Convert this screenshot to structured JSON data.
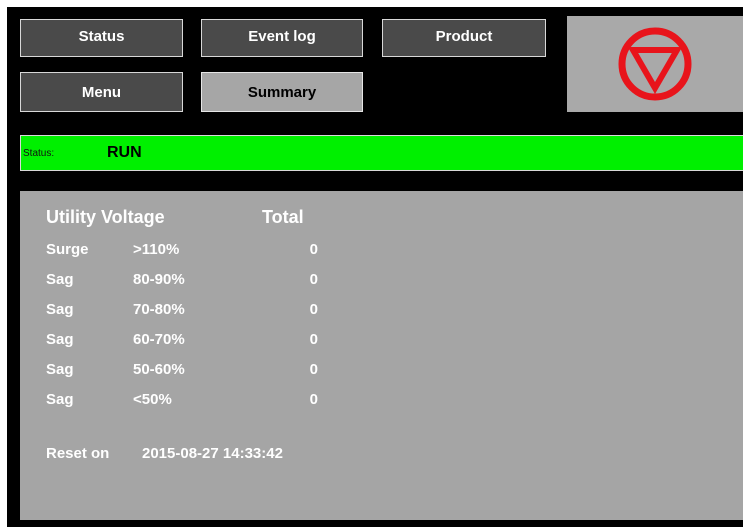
{
  "nav": {
    "status": "Status",
    "event_log": "Event log",
    "product": "Product",
    "menu": "Menu",
    "summary": "Summary",
    "active": "summary"
  },
  "alarm": {
    "icon": "stop-triangle-icon",
    "color": "#e8141b"
  },
  "status_bar": {
    "label": "Status:",
    "value": "RUN",
    "color": "#00f000"
  },
  "summary": {
    "title": "Utility Voltage",
    "total_header": "Total",
    "rows": [
      {
        "type": "Surge",
        "range": ">110%",
        "total": "0"
      },
      {
        "type": "Sag",
        "range": "80-90%",
        "total": "0"
      },
      {
        "type": "Sag",
        "range": "70-80%",
        "total": "0"
      },
      {
        "type": "Sag",
        "range": "60-70%",
        "total": "0"
      },
      {
        "type": "Sag",
        "range": "50-60%",
        "total": "0"
      },
      {
        "type": "Sag",
        "range": "<50%",
        "total": "0"
      }
    ],
    "reset_label": "Reset on",
    "reset_value": "2015-08-27 14:33:42"
  }
}
